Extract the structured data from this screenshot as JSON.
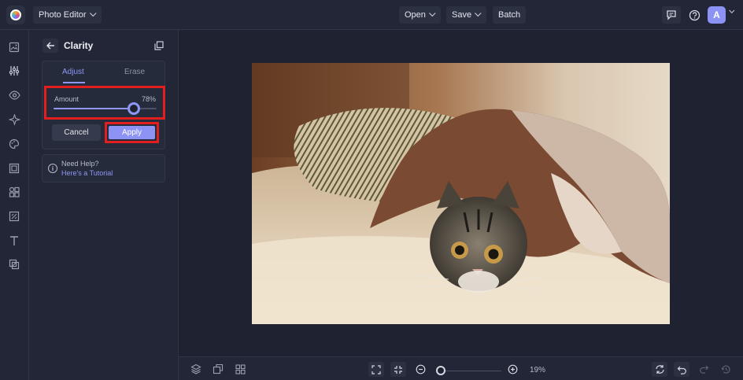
{
  "topbar": {
    "app_menu_label": "Photo Editor",
    "open_label": "Open",
    "save_label": "Save",
    "batch_label": "Batch",
    "avatar_initial": "A"
  },
  "left_toolbar": {
    "icons": [
      "image-icon",
      "sliders-icon",
      "eye-icon",
      "sparkle-icon",
      "palette-icon",
      "frame-icon",
      "shapes-icon",
      "texture-icon",
      "text-icon",
      "overlay-icon"
    ]
  },
  "panel": {
    "title": "Clarity",
    "tabs": [
      {
        "label": "Adjust",
        "active": true
      },
      {
        "label": "Erase",
        "active": false
      }
    ],
    "amount": {
      "label": "Amount",
      "value_text": "78%",
      "value": 78,
      "max": 100
    },
    "cancel_label": "Cancel",
    "apply_label": "Apply",
    "help": {
      "title": "Need Help?",
      "link": "Here's a Tutorial"
    }
  },
  "bottombar": {
    "zoom_text": "19%",
    "zoom_value": 19
  },
  "colors": {
    "accent": "#8c93f4",
    "highlight": "#e11f1f",
    "background": "#1f2331",
    "panel": "#222636"
  }
}
